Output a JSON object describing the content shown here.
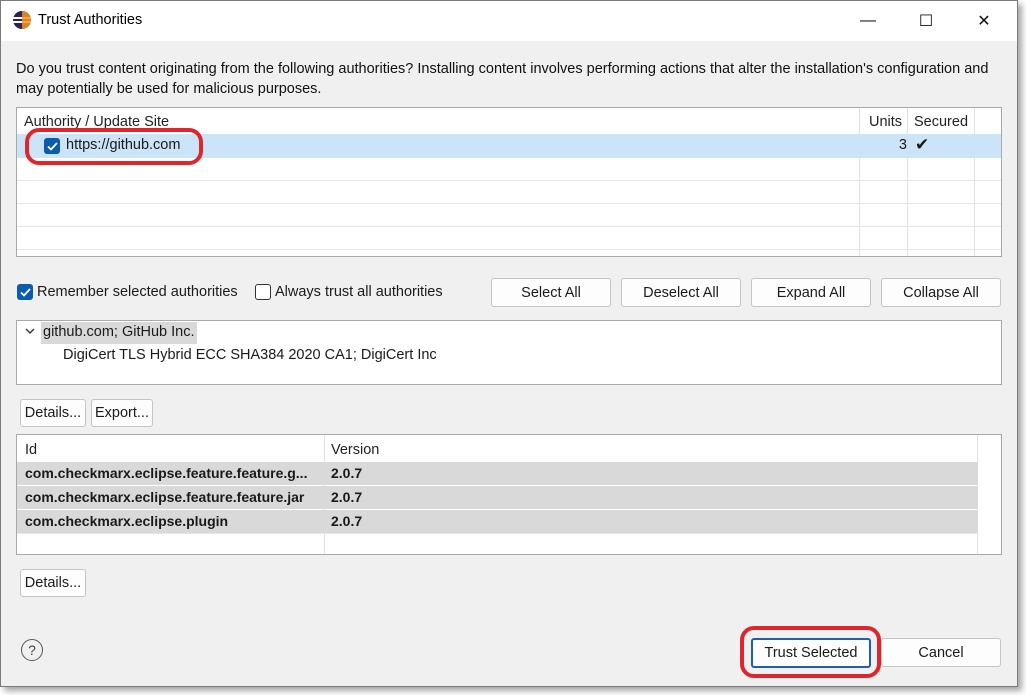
{
  "window": {
    "title": "Trust Authorities",
    "minimize_glyph": "—",
    "maximize_glyph": "☐",
    "close_glyph": "✕"
  },
  "description": "Do you trust content originating from the following authorities?  Installing content involves performing actions that alter the installation's configuration and may potentially be used for malicious purposes.",
  "authorities_table": {
    "columns": [
      "Authority / Update Site",
      "Units",
      "Secured"
    ],
    "rows": [
      {
        "site": "https://github.com",
        "units": "3",
        "secured": "✔",
        "checked": true
      }
    ]
  },
  "options": {
    "remember_label": "Remember selected authorities",
    "remember_checked": true,
    "always_trust_label": "Always trust all authorities",
    "always_trust_checked": false
  },
  "buttons": {
    "select_all": "Select All",
    "deselect_all": "Deselect All",
    "expand_all": "Expand All",
    "collapse_all": "Collapse All",
    "details": "Details...",
    "export": "Export...",
    "details_2": "Details...",
    "trust_selected": "Trust Selected",
    "cancel": "Cancel"
  },
  "certificate_tree": {
    "root": "github.com; GitHub Inc.",
    "child": "DigiCert TLS Hybrid ECC SHA384 2020 CA1; DigiCert Inc"
  },
  "units_table": {
    "columns": [
      "Id",
      "Version"
    ],
    "rows": [
      {
        "id": "com.checkmarx.eclipse.feature.feature.g...",
        "version": "2.0.7"
      },
      {
        "id": "com.checkmarx.eclipse.feature.feature.jar",
        "version": "2.0.7"
      },
      {
        "id": "com.checkmarx.eclipse.plugin",
        "version": "2.0.7"
      }
    ]
  },
  "help_glyph": "?",
  "colors": {
    "highlight_red": "#e0262d",
    "selection_blue": "#cce4f7",
    "checkbox_blue": "#0b5cad"
  }
}
